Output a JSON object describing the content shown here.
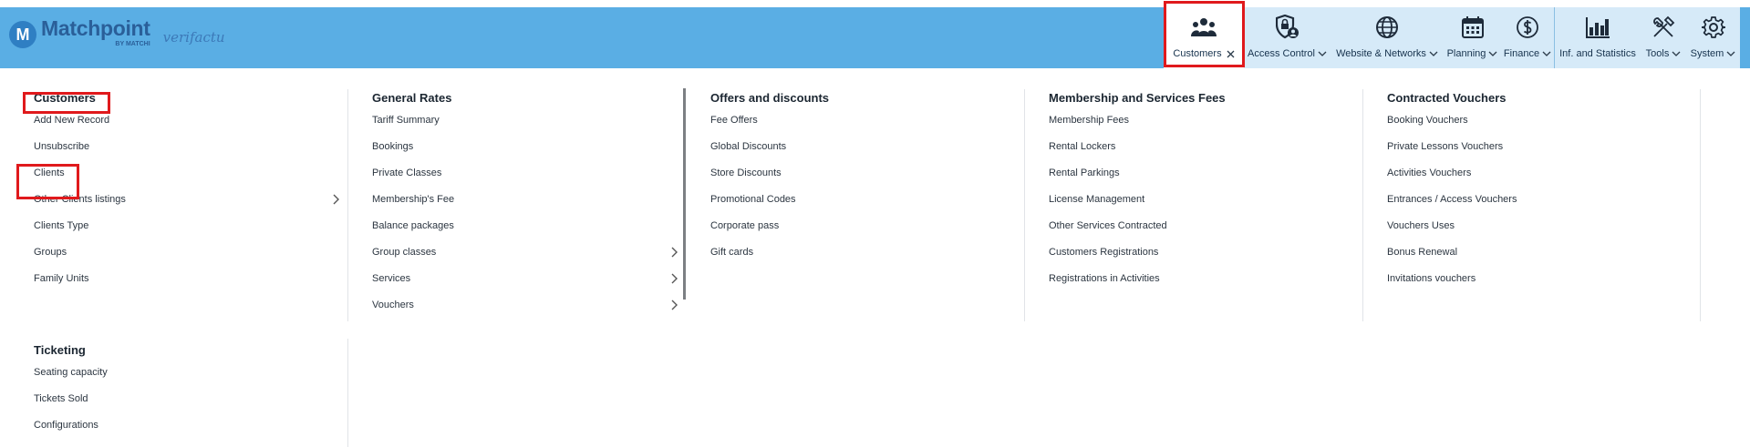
{
  "brand": {
    "logo_letter": "M",
    "name": "Matchpoint",
    "byline": "BY MATCHI",
    "partner": "verifactu"
  },
  "nav": [
    {
      "key": "customers",
      "label": "Customers",
      "icon": "people-icon",
      "active": true,
      "close": true
    },
    {
      "key": "access_control",
      "label": "Access Control",
      "icon": "shield-user-icon"
    },
    {
      "key": "website_networks",
      "label": "Website & Networks",
      "icon": "globe-icon"
    },
    {
      "key": "planning",
      "label": "Planning",
      "icon": "calendar-icon"
    },
    {
      "key": "finance",
      "label": "Finance",
      "icon": "dollar-icon"
    },
    {
      "key": "inf_statistics",
      "label": "Inf. and Statistics",
      "icon": "bar-chart-icon"
    },
    {
      "key": "tools",
      "label": "Tools",
      "icon": "tools-icon"
    },
    {
      "key": "system",
      "label": "System",
      "icon": "gear-icon"
    }
  ],
  "menu": {
    "customers": {
      "title": "Customers",
      "items": [
        "Add New Record",
        "Unsubscribe",
        "Clients",
        "Other Clients listings",
        "Clients Type",
        "Groups",
        "Family Units"
      ]
    },
    "general_rates": {
      "title": "General Rates",
      "items": [
        "Tariff Summary",
        "Bookings",
        "Private Classes",
        "Membership's Fee",
        "Balance packages",
        "Group classes",
        "Services",
        "Vouchers"
      ]
    },
    "offers": {
      "title": "Offers and discounts",
      "items": [
        "Fee Offers",
        "Global Discounts",
        "Store Discounts",
        "Promotional Codes",
        "Corporate pass",
        "Gift cards"
      ]
    },
    "membership": {
      "title": "Membership and Services Fees",
      "items": [
        "Membership Fees",
        "Rental Lockers",
        "Rental Parkings",
        "License Management",
        "Other Services Contracted",
        "Customers Registrations",
        "Registrations in Activities"
      ]
    },
    "vouchers": {
      "title": "Contracted Vouchers",
      "items": [
        "Booking Vouchers",
        "Private Lessons Vouchers",
        "Activities Vouchers",
        "Entrances / Access Vouchers",
        "Vouchers Uses",
        "Bonus Renewal",
        "Invitations vouchers"
      ]
    },
    "ticketing": {
      "title": "Ticketing",
      "items": [
        "Seating capacity",
        "Tickets Sold",
        "Configurations"
      ]
    }
  }
}
